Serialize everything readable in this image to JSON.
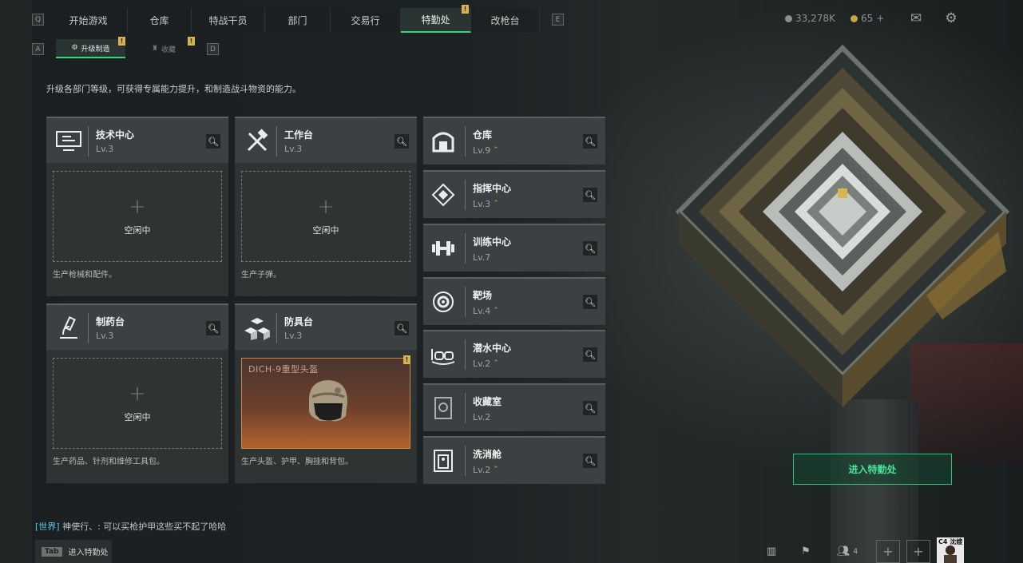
{
  "nav": {
    "left_key": "Q",
    "right_key": "E",
    "tabs": [
      {
        "label": "开始游戏"
      },
      {
        "label": "仓库"
      },
      {
        "label": "特战干员"
      },
      {
        "label": "部门"
      },
      {
        "label": "交易行"
      },
      {
        "label": "特勤处"
      },
      {
        "label": "改枪台"
      }
    ],
    "alert_mark": "!"
  },
  "resources": {
    "currency": "33,278K",
    "premium": "65",
    "premium_add": "+"
  },
  "subnav": {
    "left_key": "A",
    "right_key": "D",
    "tabs": [
      {
        "label": "升级制造"
      },
      {
        "label": "收藏"
      }
    ]
  },
  "description": "升级各部门等级，可获得专属能力提升，和制造战斗物资的能力。",
  "facilities": [
    {
      "name": "技术中心",
      "level": "Lv.3",
      "status": "空闲中",
      "footer": "生产枪械和配件。",
      "icon": "tech-center-icon"
    },
    {
      "name": "工作台",
      "level": "Lv.3",
      "status": "空闲中",
      "footer": "生产子弹。",
      "icon": "workbench-icon"
    },
    {
      "name": "制药台",
      "level": "Lv.3",
      "status": "空闲中",
      "footer": "生产药品、针剂和维修工具包。",
      "icon": "pharmacy-icon"
    },
    {
      "name": "防具台",
      "level": "Lv.3",
      "product": "DICH-9重型头盔",
      "footer": "生产头盔、护甲、胸挂和背包。",
      "icon": "armor-bench-icon"
    }
  ],
  "rows": [
    {
      "name": "仓库",
      "level": "Lv.9",
      "upgradable": true,
      "icon": "warehouse-icon"
    },
    {
      "name": "指挥中心",
      "level": "Lv.3",
      "upgradable": true,
      "icon": "command-center-icon"
    },
    {
      "name": "训练中心",
      "level": "Lv.7",
      "upgradable": false,
      "icon": "training-icon"
    },
    {
      "name": "靶场",
      "level": "Lv.4",
      "upgradable": true,
      "icon": "shooting-range-icon"
    },
    {
      "name": "潜水中心",
      "level": "Lv.2",
      "upgradable": true,
      "icon": "diving-center-icon"
    },
    {
      "name": "收藏室",
      "level": "Lv.2",
      "upgradable": false,
      "icon": "collection-room-icon"
    },
    {
      "name": "洗消舱",
      "level": "Lv.2",
      "upgradable": true,
      "icon": "decontamination-icon"
    }
  ],
  "enter_button": "进入特勤处",
  "chat": {
    "channel": "[世界]",
    "message": "神使行、: 可以买枪护甲这些买不起了哈哈"
  },
  "tab_hint": {
    "key": "Tab",
    "label": "进入特勤处"
  },
  "party": {
    "count": "4"
  },
  "avatar_text": "C4 沈嫂",
  "colors": {
    "accent_green": "#2ed87a",
    "warning_yellow": "#d8b24a",
    "upgrade_gold": "#c9a249"
  }
}
